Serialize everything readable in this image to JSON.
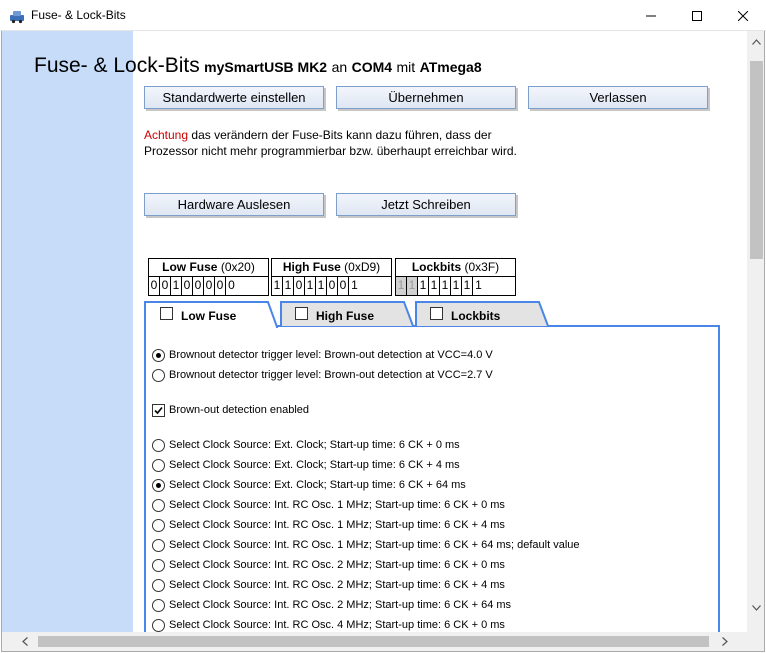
{
  "window": {
    "title": "Fuse- & Lock-Bits",
    "app_icon": "programmer-icon",
    "controls": [
      "minimize-icon",
      "maximize-icon",
      "close-icon"
    ]
  },
  "header": {
    "title": "Fuse- & Lock-Bits",
    "device": "mySmartUSB MK2",
    "on": "an",
    "port": "COM4",
    "with": "mit",
    "chip": "ATmega8"
  },
  "buttons": {
    "defaults": "Standardwerte einstellen",
    "apply": "Übernehmen",
    "exit": "Verlassen",
    "read_hw": "Hardware Auslesen",
    "write_now": "Jetzt Schreiben"
  },
  "warning": {
    "label": "Achtung",
    "text": "das verändern der Fuse-Bits kann dazu führen, dass der Prozessor nicht mehr programmierbar bzw. überhaupt erreichbar wird."
  },
  "fuses": [
    {
      "name": "Low Fuse",
      "hex": "(0x20)",
      "bits": [
        "0",
        "0",
        "1",
        "0",
        "0",
        "0",
        "0",
        "0"
      ],
      "disabled": [
        false,
        false,
        false,
        false,
        false,
        false,
        false,
        false
      ]
    },
    {
      "name": "High Fuse",
      "hex": "(0xD9)",
      "bits": [
        "1",
        "1",
        "0",
        "1",
        "1",
        "0",
        "0",
        "1"
      ],
      "disabled": [
        false,
        false,
        false,
        false,
        false,
        false,
        false,
        false
      ]
    },
    {
      "name": "Lockbits",
      "hex": "(0x3F)",
      "bits": [
        "1",
        "1",
        "1",
        "1",
        "1",
        "1",
        "1",
        "1"
      ],
      "disabled": [
        true,
        true,
        false,
        false,
        false,
        false,
        false,
        false
      ]
    }
  ],
  "tabs": [
    {
      "label": "Low Fuse",
      "active": true,
      "checked": false
    },
    {
      "label": "High Fuse",
      "active": false,
      "checked": false
    },
    {
      "label": "Lockbits",
      "active": false,
      "checked": false
    }
  ],
  "options": [
    {
      "kind": "radio",
      "checked": true,
      "label": "Brownout detector trigger level: Brown-out detection at VCC=4.0 V"
    },
    {
      "kind": "radio",
      "checked": false,
      "label": "Brownout detector trigger level: Brown-out detection at VCC=2.7 V"
    },
    {
      "kind": "check",
      "checked": true,
      "label": "Brown-out detection enabled"
    },
    {
      "kind": "radio",
      "checked": false,
      "label": "Select Clock Source: Ext. Clock; Start-up time: 6 CK + 0 ms"
    },
    {
      "kind": "radio",
      "checked": false,
      "label": "Select Clock Source: Ext. Clock; Start-up time: 6 CK + 4 ms"
    },
    {
      "kind": "radio",
      "checked": true,
      "label": "Select Clock Source: Ext. Clock; Start-up time: 6 CK + 64 ms"
    },
    {
      "kind": "radio",
      "checked": false,
      "label": "Select Clock Source: Int. RC Osc. 1 MHz; Start-up time: 6 CK + 0 ms"
    },
    {
      "kind": "radio",
      "checked": false,
      "label": "Select Clock Source: Int. RC Osc. 1 MHz; Start-up time: 6 CK + 4 ms"
    },
    {
      "kind": "radio",
      "checked": false,
      "label": "Select Clock Source: Int. RC Osc. 1 MHz; Start-up time: 6 CK + 64 ms; default value"
    },
    {
      "kind": "radio",
      "checked": false,
      "label": "Select Clock Source: Int. RC Osc. 2 MHz; Start-up time: 6 CK + 0 ms"
    },
    {
      "kind": "radio",
      "checked": false,
      "label": "Select Clock Source: Int. RC Osc. 2 MHz; Start-up time: 6 CK + 4 ms"
    },
    {
      "kind": "radio",
      "checked": false,
      "label": "Select Clock Source: Int. RC Osc. 2 MHz; Start-up time: 6 CK + 64 ms"
    },
    {
      "kind": "radio",
      "checked": false,
      "label": "Select Clock Source: Int. RC Osc. 4 MHz; Start-up time: 6 CK + 0 ms"
    }
  ],
  "colors": {
    "sidebar": "#c6dcf9",
    "accent": "#4a86e8",
    "warning": "#cc0000",
    "button_border": "#7e9fc9"
  }
}
